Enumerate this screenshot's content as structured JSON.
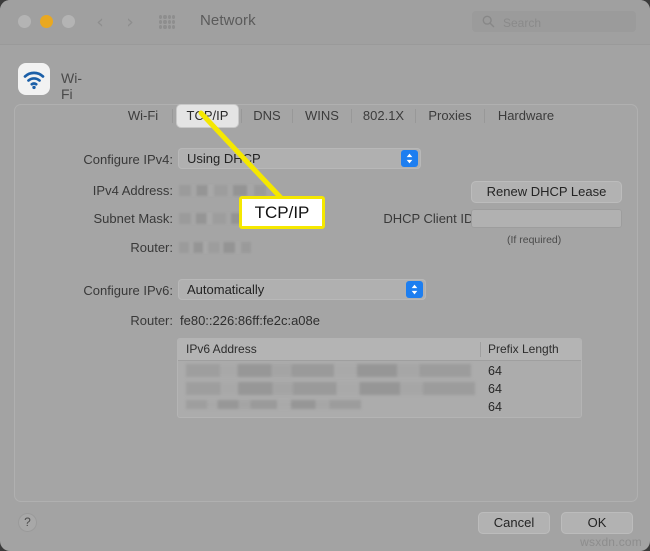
{
  "window": {
    "title": "Network",
    "traffic_lights": [
      "close",
      "minimize",
      "zoom"
    ],
    "nav_back": "‹",
    "nav_forward": "›",
    "grid_icon": "grid-apps-icon"
  },
  "search": {
    "placeholder": "Search",
    "value": ""
  },
  "service": {
    "icon": "wifi-icon",
    "name": "Wi-Fi"
  },
  "tabs": [
    {
      "label": "Wi-Fi",
      "selected": false
    },
    {
      "label": "TCP/IP",
      "selected": true
    },
    {
      "label": "DNS",
      "selected": false
    },
    {
      "label": "WINS",
      "selected": false
    },
    {
      "label": "802.1X",
      "selected": false
    },
    {
      "label": "Proxies",
      "selected": false
    },
    {
      "label": "Hardware",
      "selected": false
    }
  ],
  "ipv4": {
    "configure_label": "Configure IPv4:",
    "configure_value": "Using DHCP",
    "address_label": "IPv4 Address:",
    "address_value": "",
    "subnet_label": "Subnet Mask:",
    "subnet_value": "",
    "router_label": "Router:",
    "router_value": "",
    "renew_button": "Renew DHCP Lease",
    "client_id_label": "DHCP Client ID:",
    "client_id_value": "",
    "client_id_hint": "(If required)"
  },
  "ipv6": {
    "configure_label": "Configure IPv6:",
    "configure_value": "Automatically",
    "router_label": "Router:",
    "router_value": "fe80::226:86ff:fe2c:a08e",
    "table": {
      "columns": [
        "IPv6 Address",
        "Prefix Length"
      ],
      "rows": [
        {
          "address": "",
          "prefix_length": "64"
        },
        {
          "address": "",
          "prefix_length": "64"
        },
        {
          "address": "",
          "prefix_length": "64"
        }
      ]
    }
  },
  "footer": {
    "help_label": "?",
    "cancel_label": "Cancel",
    "ok_label": "OK"
  },
  "annotation": {
    "callout_text": "TCP/IP",
    "callout_color": "#f5e800",
    "points_to": "tab-tcpip"
  },
  "watermark": "wsxdn.com"
}
